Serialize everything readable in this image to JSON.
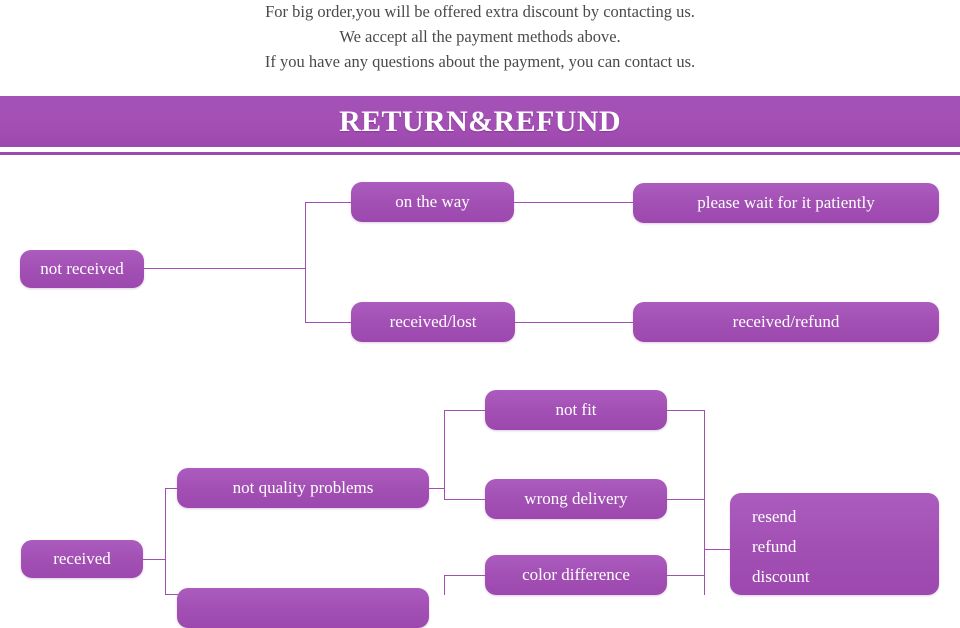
{
  "intro": {
    "lines": [
      "For big order,you will be offered extra discount by contacting us.",
      "We accept all the payment methods above.",
      "If you have any questions about the payment, you can contact us."
    ]
  },
  "banner": {
    "title": "RETURN&REFUND",
    "background_color": "#a34fb4",
    "text_color": "#ffffff",
    "rule_color": "#9d4aaf"
  },
  "theme": {
    "node_fill": "#a350b5",
    "node_text": "#ffffff",
    "connector_color": "#a24fb2",
    "page_background": "#ffffff",
    "intro_text_color": "#4a4a4a"
  },
  "flowchart": {
    "branch_not_received": {
      "root": "not received",
      "children": [
        {
          "condition": "on the way",
          "outcome": "please wait for it patiently"
        },
        {
          "condition": "received/lost",
          "outcome": "received/refund"
        }
      ]
    },
    "branch_received": {
      "root": "received",
      "category_not_quality": "not quality problems",
      "reasons": [
        "not fit",
        "wrong delivery",
        "color difference"
      ],
      "resolutions": [
        "resend",
        "refund",
        "discount"
      ]
    }
  }
}
